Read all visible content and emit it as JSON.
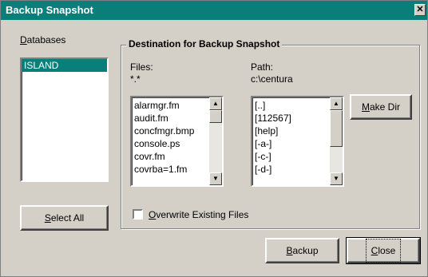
{
  "window": {
    "title": "Backup Snapshot",
    "close_glyph": "✕"
  },
  "databases": {
    "label": "Databases",
    "items": [
      "ISLAND"
    ],
    "selected_index": 0,
    "select_all_label": "Select All"
  },
  "destination": {
    "group_title": "Destination for Backup Snapshot",
    "files_label": "Files:",
    "files_filter": "*.*",
    "path_label": "Path:",
    "path_value": "c:\\centura",
    "files": [
      "alarmgr.fm",
      "audit.fm",
      "concfmgr.bmp",
      "console.ps",
      "covr.fm",
      "covrba=1.fm"
    ],
    "dirs": [
      "[..]",
      "[112567]",
      "[help]",
      "[-a-]",
      "[-c-]",
      "[-d-]"
    ],
    "make_dir_label": "Make Dir",
    "overwrite_label": "Overwrite Existing Files",
    "overwrite_checked": false
  },
  "actions": {
    "backup_label": "Backup",
    "close_label": "Close"
  },
  "colors": {
    "titlebar": "#0a7f7a",
    "selection": "#0a7f7a",
    "face": "#d4d0c8"
  },
  "icons": {
    "scroll_up": "▲",
    "scroll_down": "▼"
  }
}
